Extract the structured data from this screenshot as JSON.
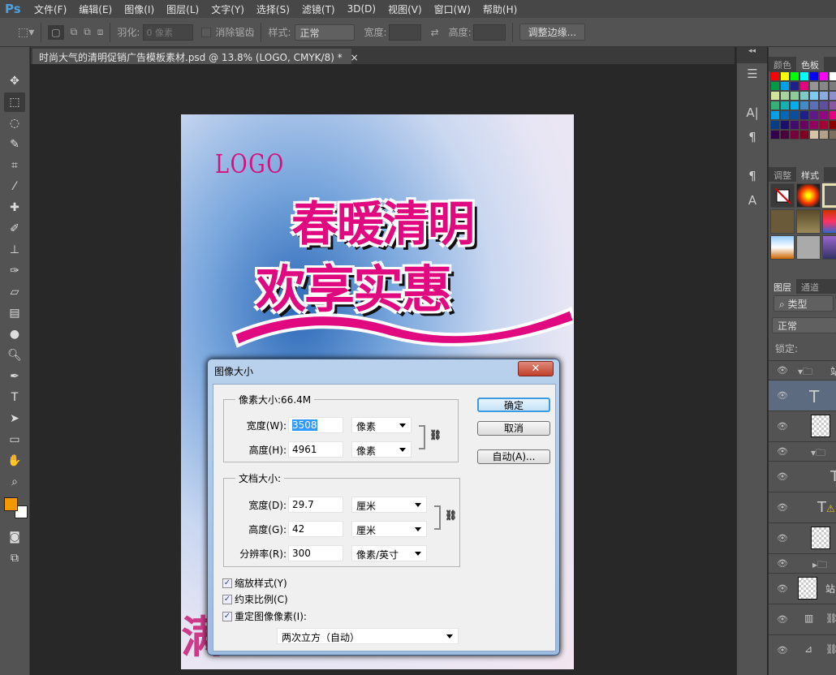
{
  "app": {
    "logo": "Ps"
  },
  "menu": [
    "文件(F)",
    "编辑(E)",
    "图像(I)",
    "图层(L)",
    "文字(Y)",
    "选择(S)",
    "滤镜(T)",
    "3D(D)",
    "视图(V)",
    "窗口(W)",
    "帮助(H)"
  ],
  "options": {
    "feather_label": "羽化:",
    "feather_value": "0 像素",
    "antialias_label": "消除锯齿",
    "style_label": "样式:",
    "style_value": "正常",
    "width_label": "宽度:",
    "height_label": "高度:",
    "refine_edge": "调整边缘..."
  },
  "document_tab": {
    "title": "时尚大气的清明促销广告模板素材.psd @ 13.8% (LOGO, CMYK/8) *",
    "close": "×"
  },
  "canvas": {
    "logo": "LOGO",
    "headline1": "春暖清明",
    "headline2": "欢享实惠",
    "bottom_text": "满"
  },
  "dialog": {
    "title": "图像大小",
    "close": "✕",
    "pixel_dims_label": "像素大小:66.4M",
    "px_width_label": "宽度(W):",
    "px_width": "3508",
    "px_width_unit": "像素",
    "px_height_label": "高度(H):",
    "px_height": "4961",
    "px_height_unit": "像素",
    "doc_size_label": "文档大小:",
    "doc_width_label": "宽度(D):",
    "doc_width": "29.7",
    "doc_width_unit": "厘米",
    "doc_height_label": "高度(G):",
    "doc_height": "42",
    "doc_height_unit": "厘米",
    "resolution_label": "分辨率(R):",
    "resolution": "300",
    "resolution_unit": "像素/英寸",
    "scale_styles": "缩放样式(Y)",
    "constrain": "约束比例(C)",
    "resample": "重定图像像素(I):",
    "resample_method": "两次立方（自动）",
    "ok": "确定",
    "cancel": "取消",
    "auto": "自动(A)..."
  },
  "panels": {
    "color_tabs": [
      "颜色",
      "色板"
    ],
    "swatches": [
      "#ff0000",
      "#ffff00",
      "#00ff00",
      "#00ffff",
      "#0000ff",
      "#ff00ff",
      "#ffffff",
      "#009944",
      "#00a0e9",
      "#1d2088",
      "#e4007f",
      "#959595",
      "#888888",
      "#7d7d7d",
      "#d2e39a",
      "#a7d49a",
      "#8ccb9a",
      "#7ecbc8",
      "#7ccbf0",
      "#89abe0",
      "#8e90cc",
      "#33b277",
      "#13b1b1",
      "#00aeef",
      "#448acb",
      "#5a6fb5",
      "#5d50a0",
      "#8957a1",
      "#00a0e9",
      "#0068b7",
      "#0a4e9d",
      "#1d2088",
      "#601986",
      "#920783",
      "#e4007f",
      "#003f87",
      "#1a0f6b",
      "#430c6c",
      "#6a005f",
      "#940060",
      "#a40035",
      "#8b0000",
      "#33004e",
      "#4b003e",
      "#750039",
      "#7d0022",
      "#d7c4a8",
      "#b3a08a",
      "#7d6f60"
    ],
    "style_tabs": [
      "调整",
      "样式"
    ],
    "layer_tabs": [
      "图层",
      "通道"
    ],
    "layer_filter": "类型",
    "blend_mode": "正常",
    "lock_label": "锁定:",
    "layer_names": [
      "站",
      "站"
    ]
  }
}
